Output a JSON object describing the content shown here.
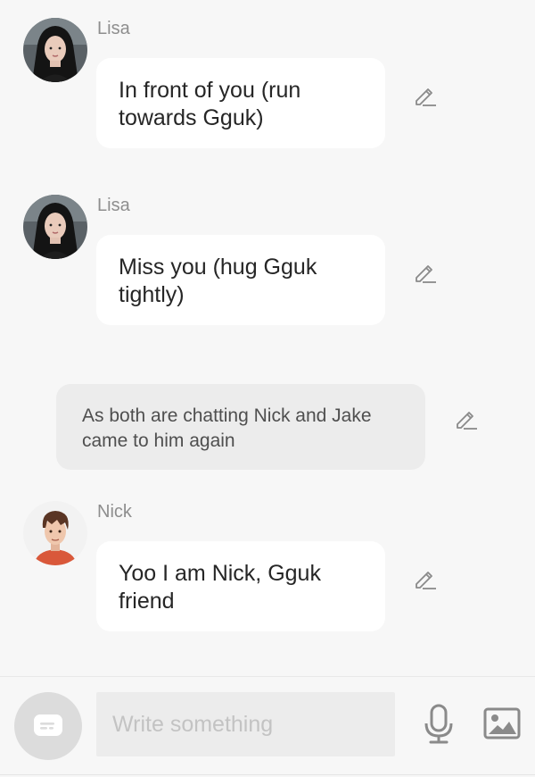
{
  "messages": [
    {
      "sender": "Lisa",
      "text": "In front of you (run towards Gguk)",
      "avatar": "lisa-avatar"
    },
    {
      "sender": "Lisa",
      "text": "Miss you (hug Gguk tightly)",
      "avatar": "lisa-avatar"
    },
    {
      "sender": "Nick",
      "text": "Yoo I am Nick, Gguk friend",
      "avatar": "nick-avatar"
    }
  ],
  "narration": {
    "text": "As both are chatting Nick and Jake came to him again"
  },
  "input": {
    "placeholder": "Write something"
  },
  "icons": {
    "edit": "pencil-icon",
    "mode": "chat-bubble-icon",
    "mic": "microphone-icon",
    "image": "image-icon"
  },
  "colors": {
    "background": "#f7f7f7",
    "bubble": "#ffffff",
    "narration_bubble": "#ececec",
    "sender_name": "#8e8e8e",
    "message_text": "#262626",
    "icon": "#8a8a8a"
  }
}
